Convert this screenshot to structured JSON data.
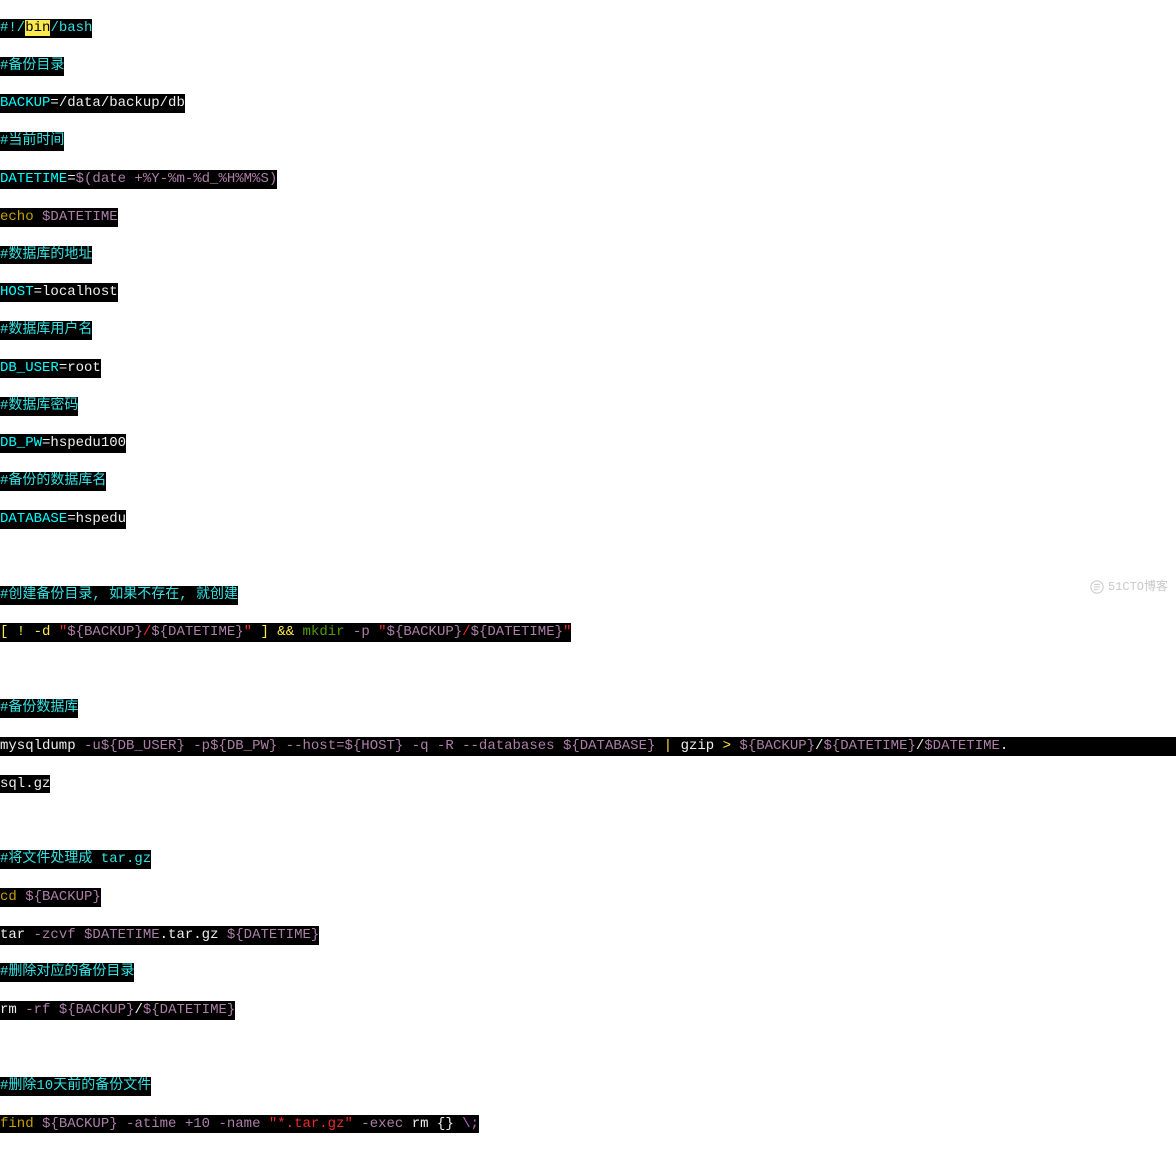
{
  "lines": {
    "l1_shebang_hash": "#!/",
    "l1_bin": "bin",
    "l1_bash": "/bash",
    "l2_comment": "#备份目录",
    "l3_var": "BACKUP",
    "l3_assign": "=/data/backup/db",
    "l4_comment": "#当前时间",
    "l5_var": "DATETIME",
    "l5_eq": "=",
    "l5_val": "$(date +%Y-%m-%d_%H%M%S)",
    "l6_echo": "echo ",
    "l6_var": "$DATETIME",
    "l7_comment": "#数据库的地址",
    "l8_var": "HOST",
    "l8_assign": "=localhost",
    "l9_comment": "#数据库用户名",
    "l10_var": "DB_USER",
    "l10_assign": "=root",
    "l11_comment": "#数据库密码",
    "l12_var": "DB_PW",
    "l12_assign": "=hspedu100",
    "l13_comment": "#备份的数据库名",
    "l14_var": "DATABASE",
    "l14_assign": "=hspedu",
    "l16_comment": "#创建备份目录, 如果不存在, 就创建",
    "l17_a": "[ ! -d ",
    "l17_b": "\"",
    "l17_c": "${BACKUP}",
    "l17_d": "/",
    "l17_e": "${DATETIME}",
    "l17_f": "\"",
    "l17_g": " ] ",
    "l17_h": "&&",
    "l17_i": " mkdir ",
    "l17_j": "-p ",
    "l17_k": "\"",
    "l17_l": "${BACKUP}",
    "l17_m": "/",
    "l17_n": "${DATETIME}",
    "l17_o": "\"",
    "l19_comment": "#备份数据库",
    "l20_a": "mysqldump ",
    "l20_b": "-u",
    "l20_c": "${DB_USER}",
    "l20_d": " -p",
    "l20_e": "${DB_PW}",
    "l20_f": " --host=",
    "l20_g": "${HOST}",
    "l20_h": " -q -R --databases ",
    "l20_i": "${DATABASE}",
    "l20_j": " | ",
    "l20_k": "gzip",
    "l20_l": " > ",
    "l20_m": "${BACKUP}",
    "l20_n": "/",
    "l20_o": "${DATETIME}",
    "l20_p": "/",
    "l20_q": "$DATETIME",
    "l20_r": ".",
    "l21_a": "sql.gz",
    "l23_comment": "#将文件处理成 tar.gz",
    "l24_a": "cd ",
    "l24_b": "${BACKUP}",
    "l25_a": "tar ",
    "l25_b": "-zcvf ",
    "l25_c": "$DATETIME",
    "l25_d": ".tar.gz ",
    "l25_e": "${DATETIME}",
    "l26_comment": "#删除对应的备份目录",
    "l27_a": "rm ",
    "l27_b": "-rf ",
    "l27_c": "${BACKUP}",
    "l27_d": "/",
    "l27_e": "${DATETIME}",
    "l29_comment": "#删除10天前的备份文件",
    "l30_a": "find ",
    "l30_b": "${BACKUP}",
    "l30_c": " -atime +10 -name ",
    "l30_d": "\"*.tar.gz\"",
    "l30_e": " -exec ",
    "l30_f": "rm ",
    "l30_g": "{} ",
    "l30_h": "\\;"
  },
  "watermark": "51CTO博客"
}
